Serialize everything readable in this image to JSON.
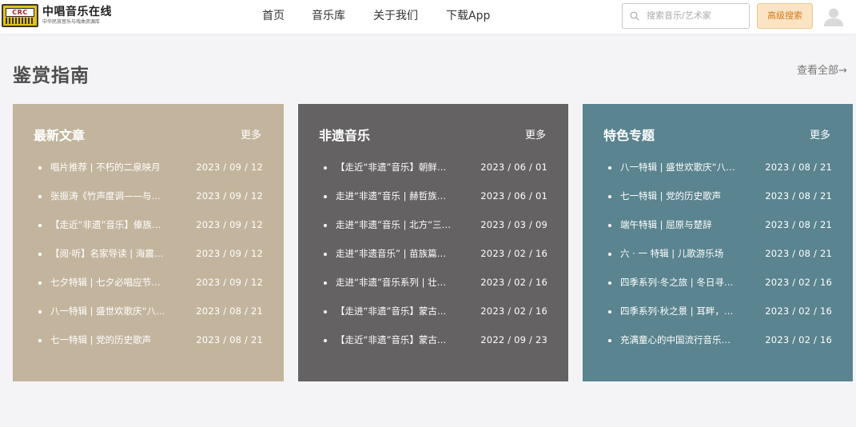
{
  "brand": {
    "name": "中唱音乐在线",
    "subtitle": "中华民族音乐与戏曲资源库",
    "logo_text": "CRC"
  },
  "nav": {
    "items": [
      {
        "label": "首页"
      },
      {
        "label": "音乐库"
      },
      {
        "label": "关于我们"
      },
      {
        "label": "下载App"
      }
    ]
  },
  "search": {
    "placeholder": "搜索音乐/艺术家",
    "value": "",
    "advanced_label": "高级搜索"
  },
  "section": {
    "title": "鉴赏指南",
    "view_all": "查看全部→"
  },
  "colors": {
    "card_1": "#c3b59d",
    "card_2": "#656263",
    "card_3": "#5a848f",
    "accent_button_bg": "#fbe4c4",
    "accent_button_text": "#d07a1c"
  },
  "cards": [
    {
      "title": "最新文章",
      "more": "更多",
      "items": [
        {
          "title": "唱片推荐 | 不朽的二泉映月",
          "date": "2023 / 09 / 12"
        },
        {
          "title": "张振涛《竹声度调——与…",
          "date": "2023 / 09 / 12"
        },
        {
          "title": "【走近“非遗”音乐】傣族…",
          "date": "2023 / 09 / 12"
        },
        {
          "title": "【阅·听】名家导读 | 海震…",
          "date": "2023 / 09 / 12"
        },
        {
          "title": "七夕特辑 | 七夕必唱应节…",
          "date": "2023 / 09 / 12"
        },
        {
          "title": "八一特辑 | 盛世欢歌庆“八…",
          "date": "2023 / 08 / 21"
        },
        {
          "title": "七一特辑 | 党的历史歌声",
          "date": "2023 / 08 / 21"
        }
      ]
    },
    {
      "title": "非遗音乐",
      "more": "更多",
      "items": [
        {
          "title": "【走近“非遗”音乐】朝鲜…",
          "date": "2023 / 06 / 01"
        },
        {
          "title": "走进“非遗”音乐 | 赫哲族…",
          "date": "2023 / 06 / 01"
        },
        {
          "title": "走进“非遗”音乐 | 北方“三…",
          "date": "2023 / 03 / 09"
        },
        {
          "title": "走进“非遗音乐” | 苗族篇…",
          "date": "2023 / 02 / 16"
        },
        {
          "title": "走进“非遗”音乐系列 | 壮…",
          "date": "2023 / 02 / 16"
        },
        {
          "title": "【走进“非遗”音乐】蒙古…",
          "date": "2023 / 02 / 16"
        },
        {
          "title": "【走近“非遗”音乐】蒙古…",
          "date": "2022 / 09 / 23"
        }
      ]
    },
    {
      "title": "特色专题",
      "more": "更多",
      "items": [
        {
          "title": "八一特辑 | 盛世欢歌庆“八…",
          "date": "2023 / 08 / 21"
        },
        {
          "title": "七一特辑 | 党的历史歌声",
          "date": "2023 / 08 / 21"
        },
        {
          "title": "端午特辑 | 屈原与楚辞",
          "date": "2023 / 08 / 21"
        },
        {
          "title": "六 · 一 特辑 | 儿歌游乐场",
          "date": "2023 / 08 / 21"
        },
        {
          "title": "四季系列·冬之旅 | 冬日寻…",
          "date": "2023 / 02 / 16"
        },
        {
          "title": "四季系列·秋之景 | 耳畔，…",
          "date": "2023 / 02 / 16"
        },
        {
          "title": "充满童心的中国流行音乐…",
          "date": "2023 / 02 / 16"
        }
      ]
    }
  ]
}
